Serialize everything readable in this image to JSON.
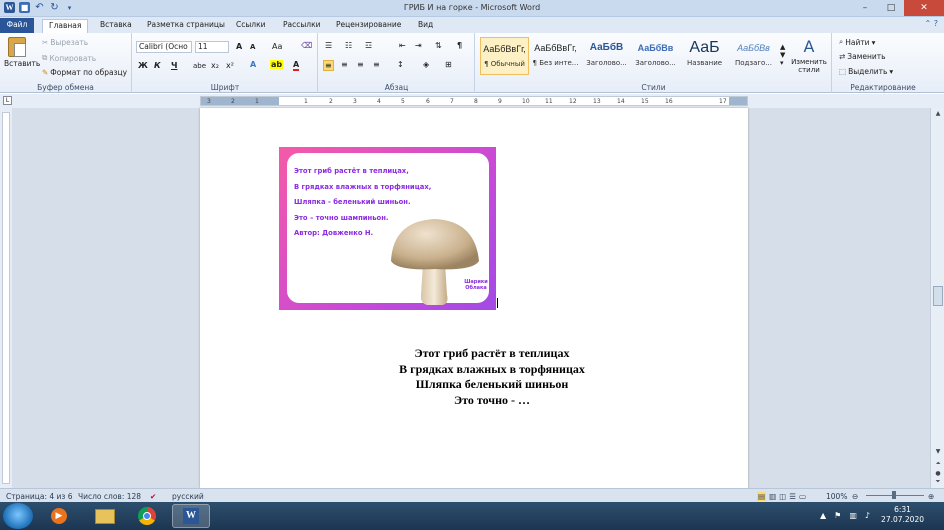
{
  "window": {
    "title": "ГРИБ И на горке - Microsoft Word",
    "controls": {
      "minimize": "–",
      "maximize": "□",
      "close": "✕"
    }
  },
  "ribbon_tabs": [
    "Файл",
    "Главная",
    "Вставка",
    "Разметка страницы",
    "Ссылки",
    "Рассылки",
    "Рецензирование",
    "Вид"
  ],
  "active_tab": "Главная",
  "clipboard": {
    "paste": "Вставить",
    "cut": "Вырезать",
    "copy": "Копировать",
    "format_painter": "Формат по образцу",
    "label": "Буфер обмена"
  },
  "font": {
    "name": "Calibri (Осно",
    "size": "11",
    "grow": "A",
    "shrink": "A",
    "case": "Aa",
    "bold": "Ж",
    "italic": "К",
    "underline": "Ч",
    "strike": "abe",
    "subscript": "x₂",
    "superscript": "x²",
    "label": "Шрифт"
  },
  "paragraph": {
    "label": "Абзац",
    "show_marks": "¶"
  },
  "styles": {
    "items": [
      {
        "preview": "АаБбВвГг,",
        "name": "¶ Обычный"
      },
      {
        "preview": "АаБбВвГг,",
        "name": "¶ Без инте..."
      },
      {
        "preview": "АаБбВ",
        "name": "Заголово..."
      },
      {
        "preview": "АаБбВв",
        "name": "Заголово..."
      },
      {
        "preview": "АаБ",
        "name": "Название"
      },
      {
        "preview": "АаБбВв",
        "name": "Подзаго..."
      }
    ],
    "change": "Изменить стили",
    "label": "Стили"
  },
  "editing": {
    "find": "Найти",
    "replace": "Заменить",
    "select": "Выделить",
    "label": "Редактирование"
  },
  "ruler_numbers": [
    "3",
    "2",
    "1",
    "1",
    "2",
    "3",
    "4",
    "5",
    "6",
    "7",
    "8",
    "9",
    "10",
    "11",
    "12",
    "13",
    "14",
    "15",
    "16",
    "17"
  ],
  "picture": {
    "lines": [
      "Этот гриб растёт в теплицах,",
      "В грядках влажных в торфяницах,",
      "Шляпка - беленький шиньон.",
      "Это – точно шампиньон.",
      "Автор: Довженко Н."
    ],
    "brand": "Шарики Облака"
  },
  "poem": {
    "lines": [
      "Этот гриб растёт в теплицах",
      "В грядках влажных в торфяницах",
      "Шляпка беленький шиньон",
      "Это точно - …"
    ]
  },
  "status": {
    "page": "Страница: 4 из 6",
    "words": "Число слов: 128",
    "language": "русский",
    "zoom": "100%"
  },
  "taskbar": {
    "time": "6:31",
    "date": "27.07.2020"
  },
  "colors": {
    "file_tab": "#2a5699",
    "picture_gradient_start": "#f55aa8",
    "picture_gradient_end": "#a24ae6",
    "picture_text": "#8a2be2"
  }
}
